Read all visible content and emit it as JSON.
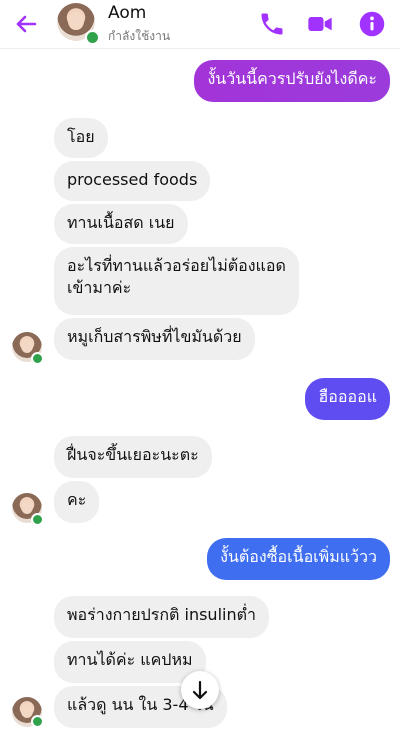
{
  "header": {
    "name": "Aom",
    "status": "กำลังใช้งาน",
    "accent": "#a033ff"
  },
  "icons": [
    "back-arrow-icon",
    "phone-icon",
    "video-camera-icon",
    "info-icon",
    "arrow-down-icon"
  ],
  "messages": [
    {
      "side": "out",
      "text": "งั้นวันนี้ควรปรับยังไงดีคะ"
    },
    {
      "side": "in",
      "text": "โอย"
    },
    {
      "side": "in",
      "text": "processed foods"
    },
    {
      "side": "in",
      "text": "ทานเนื้อสด เนย"
    },
    {
      "side": "in",
      "text_line1": "อะไรที่ทานแล้วอร่อยไม่ต้องแอด",
      "text_line2": "เข้ามาค่ะ"
    },
    {
      "side": "in",
      "text": "หมูเก็บสารพิษที่ไขมันด้วย"
    },
    {
      "side": "out",
      "text": "ฮืออออแ"
    },
    {
      "side": "in",
      "text": "ฝื่นจะขึ้นเยอะนะตะ"
    },
    {
      "side": "in",
      "text": "คะ"
    },
    {
      "side": "out",
      "text": "งั้นต้องซื้อเนื้อเพิ่มแว้วว"
    },
    {
      "side": "in",
      "text": "พอร่างกายปรกติ insulinต่ำ"
    },
    {
      "side": "in",
      "text": "ทานได้ค่ะ แคปหม"
    },
    {
      "side": "in",
      "text": "แล้วดู นน ใน 3-4 วัน"
    }
  ]
}
